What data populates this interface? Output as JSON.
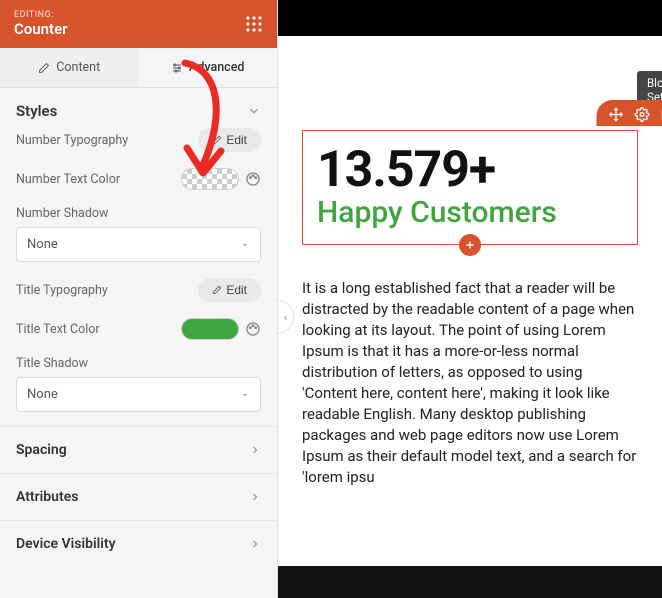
{
  "header": {
    "eyebrow": "EDITING:",
    "title": "Counter"
  },
  "tabs": {
    "content": "Content",
    "advanced": "Advanced"
  },
  "styles": {
    "title": "Styles",
    "number_typography_label": "Number Typography",
    "edit_label": "Edit",
    "number_text_color_label": "Number Text Color",
    "number_shadow_label": "Number Shadow",
    "number_shadow_value": "None",
    "title_typography_label": "Title Typography",
    "title_text_color_label": "Title Text Color",
    "title_text_color_value": "#3FA63F",
    "title_shadow_label": "Title Shadow",
    "title_shadow_value": "None"
  },
  "sections": {
    "spacing": "Spacing",
    "attributes": "Attributes",
    "device_visibility": "Device Visibility"
  },
  "preview": {
    "block_settings_label": "Block Settings",
    "counter_number": "13.579+",
    "counter_title": "Happy Customers",
    "body_text": "It is a long established fact that a reader will be distracted by the readable content of a page when looking at its layout. The point of using Lorem Ipsum is that it has a more-or-less normal distribution of letters, as opposed to using 'Content here, content here', making it look like readable English. Many desktop publishing packages and web page editors now use Lorem Ipsum as their default model text, and a search for 'lorem ipsu"
  }
}
